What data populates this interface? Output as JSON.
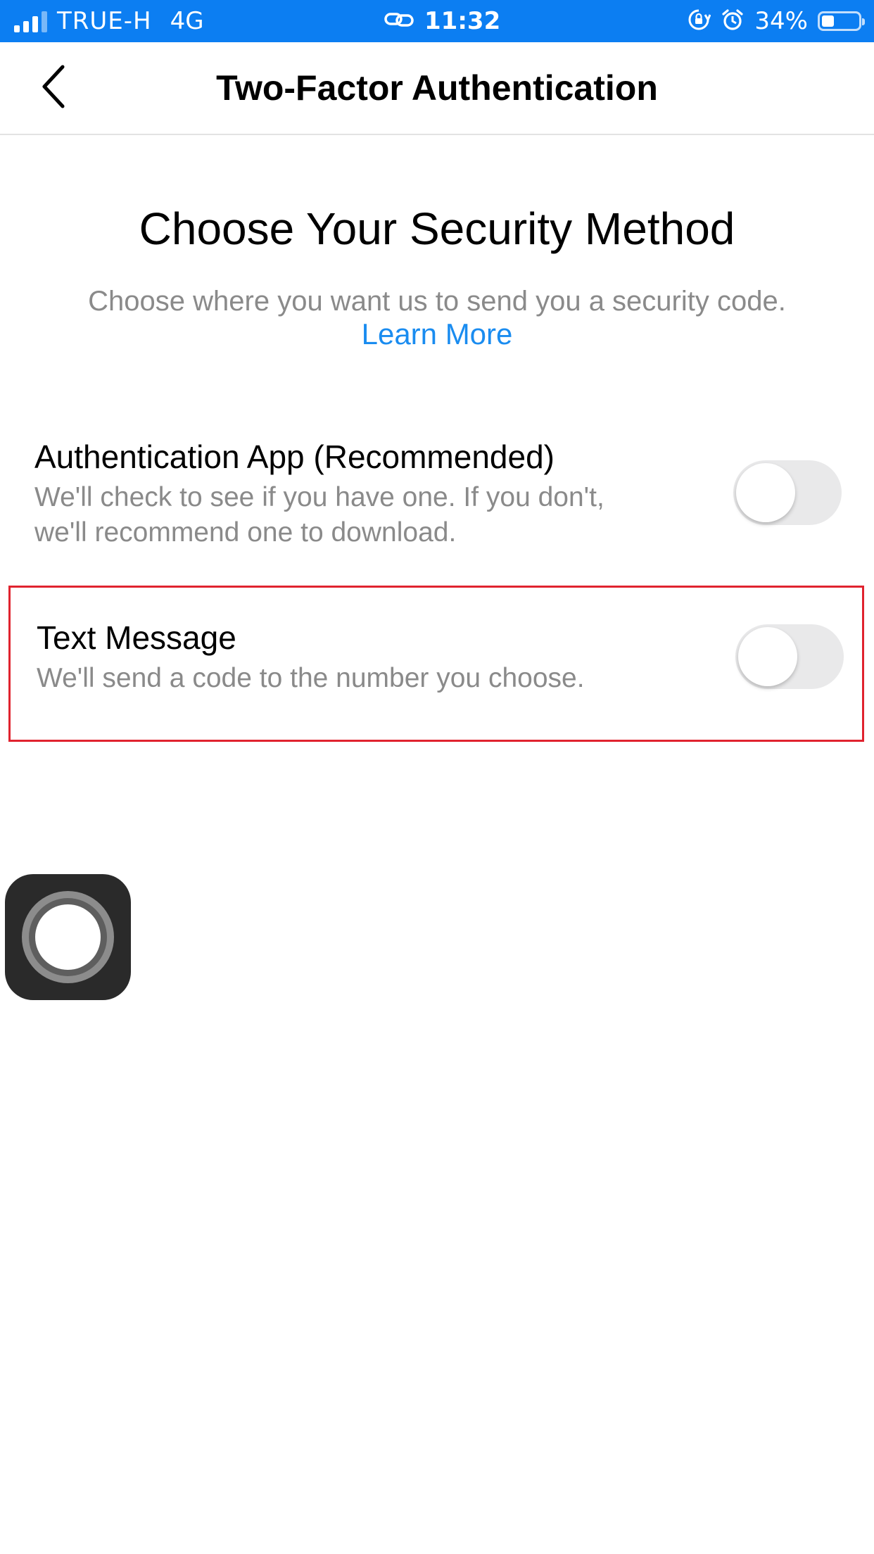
{
  "status_bar": {
    "carrier": "TRUE-H",
    "network": "4G",
    "time": "11:32",
    "battery_percent": "34%",
    "battery_level": 0.34,
    "icons": [
      "signal-icon",
      "link-icon",
      "orientation-lock-icon",
      "alarm-icon",
      "battery-icon"
    ]
  },
  "header": {
    "title": "Two-Factor Authentication",
    "back_icon": "chevron-left-icon"
  },
  "main": {
    "heading": "Choose Your Security Method",
    "subtitle": "Choose where you want us to send you a security code.",
    "learn_more": "Learn More",
    "options": [
      {
        "title": "Authentication App (Recommended)",
        "desc_line1": "We'll check to see if you have one. If you don't,",
        "desc_line2": "we'll recommend one to download.",
        "enabled": false
      },
      {
        "title": "Text Message",
        "desc_line1": "We'll send a code to the number you choose.",
        "enabled": false
      }
    ]
  },
  "colors": {
    "status_bar_bg": "#0c7ef2",
    "link": "#1a8cf0",
    "highlight_border": "#e0232f",
    "secondary_text": "#8a8a8a",
    "toggle_off": "#e9e9ea"
  },
  "overlay": {
    "assistive_touch_icon": "assistive-touch-icon"
  }
}
